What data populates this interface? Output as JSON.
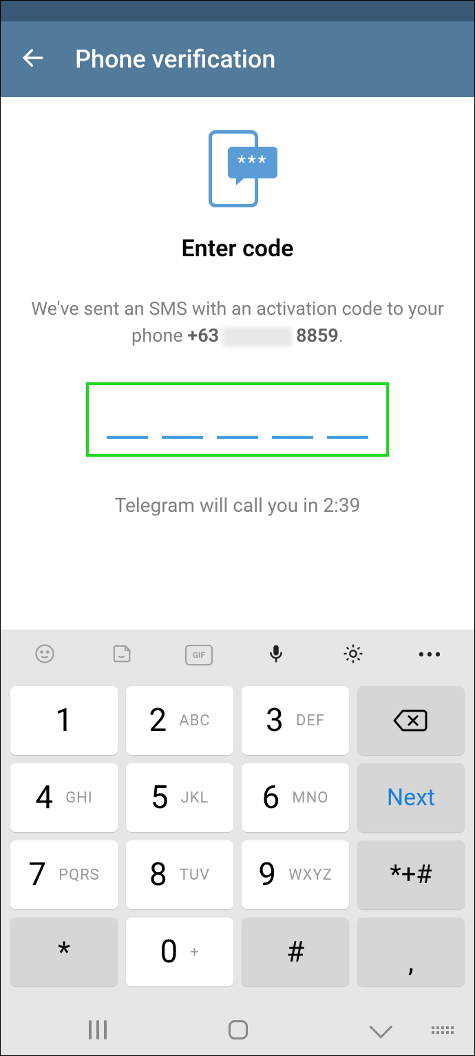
{
  "header": {
    "title": "Phone verification"
  },
  "content": {
    "title": "Enter code",
    "desc_prefix": "We've sent an SMS with an activation code to your phone ",
    "phone_cc": "+63",
    "phone_last": "8859",
    "timer_text": "Telegram will call you in 2:39",
    "illustration_stars": "***"
  },
  "keyboard": {
    "toolbar": {
      "gif": "GIF",
      "more": "•••"
    },
    "keys": {
      "one": "1",
      "one_sub": "",
      "two": "2",
      "two_sub": "ABC",
      "three": "3",
      "three_sub": "DEF",
      "four": "4",
      "four_sub": "GHI",
      "five": "5",
      "five_sub": "JKL",
      "six": "6",
      "six_sub": "MNO",
      "seven": "7",
      "seven_sub": "PQRS",
      "eight": "8",
      "eight_sub": "TUV",
      "nine": "9",
      "nine_sub": "WXYZ",
      "zero": "0",
      "zero_sub": "+",
      "star": "*",
      "hash": "#",
      "symbols": "*+#",
      "comma": ",",
      "next": "Next"
    }
  }
}
